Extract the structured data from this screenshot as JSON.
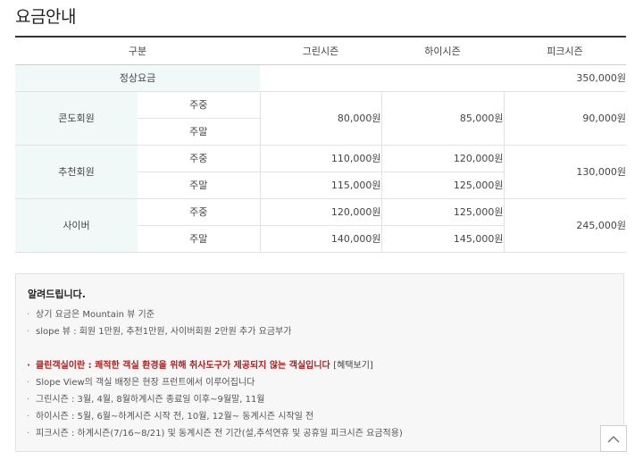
{
  "page": {
    "title": "요금안내"
  },
  "table": {
    "headers": [
      "구분",
      "그린시즌",
      "하이시즌",
      "피크시즌"
    ],
    "regular": {
      "label": "정상요금",
      "value": "350,000원"
    },
    "condo": {
      "label": "콘도회원",
      "weekday": "주중",
      "weekend": "주말",
      "green": "80,000원",
      "high": "85,000원",
      "peak": "90,000원"
    },
    "referral": {
      "label": "추천회원",
      "weekday": "주중",
      "weekend": "주말",
      "green_weekday": "110,000원",
      "high_weekday": "120,000원",
      "green_weekend": "115,000원",
      "high_weekend": "125,000원",
      "peak": "130,000원"
    },
    "cyber": {
      "label": "사이버",
      "weekday": "주중",
      "weekend": "주말",
      "green_weekday": "120,000원",
      "high_weekday": "125,000원",
      "green_weekend": "140,000원",
      "high_weekend": "145,000원",
      "peak": "245,000원"
    }
  },
  "notice": {
    "title": "알려드립니다.",
    "items_a": [
      "상기 요금은 Mountain 뷰 기준",
      "slope 뷰 : 회원 1만원, 추천1만원, 사이버회원 2만원 추가 요금부가"
    ],
    "highlight": {
      "text": "클린객실이란 : 쾌적한 객실 환경을 위해 취사도구가 제공되지 않는 객실입니다",
      "link": "[혜택보기]"
    },
    "items_b": [
      "Slope View의 객실 배정은 현장 프런트에서 이루어집니다",
      "그린시즌 : 3월, 4월, 8월하계시즌 종료일 이후~9월말, 11월",
      "하이시즌 : 5월, 6월~하계시즌 시작 전, 10월, 12월~ 동계시즌 시작일 전",
      "피크시즌 : 하계시즌(7/16~8/21) 및 동계시즌 전 기간(설,추석연휴 및 공휴일 피크시즌 요금적용)"
    ]
  },
  "icons": {
    "scroll_top": "chevron-up-icon"
  }
}
